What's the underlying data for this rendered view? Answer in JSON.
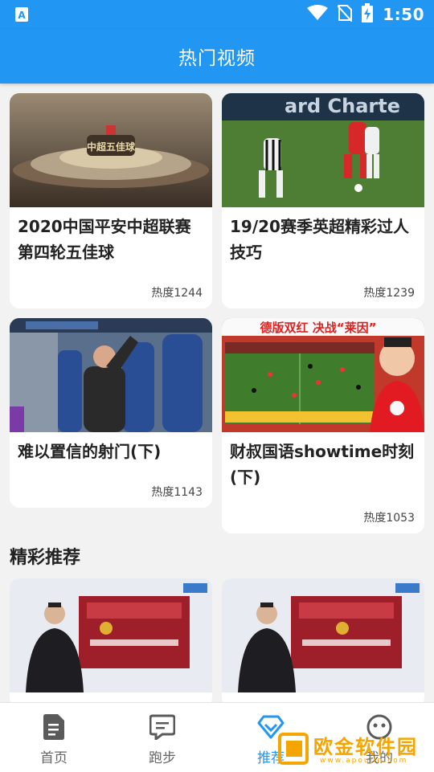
{
  "status_bar": {
    "time": "1:50"
  },
  "app_bar": {
    "title": "热门视频"
  },
  "hot_videos": [
    {
      "title": "2020中国平安中超联赛第四轮五佳球",
      "heat": "热度1244",
      "thumb_caption": "中超五佳球"
    },
    {
      "title": "19/20赛季英超精彩过人技巧",
      "heat": "热度1239",
      "thumb_caption": "ard Charte"
    },
    {
      "title": "难以置信的射门(下)",
      "heat": "热度1143"
    },
    {
      "title": "财叔国语showtime时刻(下)",
      "heat": "热度1053",
      "thumb_caption": "德版双红  决战“莱因”"
    }
  ],
  "recommend": {
    "title": "精彩推荐"
  },
  "bottom_nav": [
    {
      "label": "首页",
      "icon": "document-icon"
    },
    {
      "label": "跑步",
      "icon": "chat-icon"
    },
    {
      "label": "推荐",
      "icon": "diamond-icon"
    },
    {
      "label": "我的",
      "icon": "smiley-icon"
    }
  ],
  "watermark": {
    "text": "欧金软件园",
    "url": "www.apoujin.com"
  },
  "colors": {
    "primary": "#2196f3",
    "watermark": "#f5a500"
  }
}
